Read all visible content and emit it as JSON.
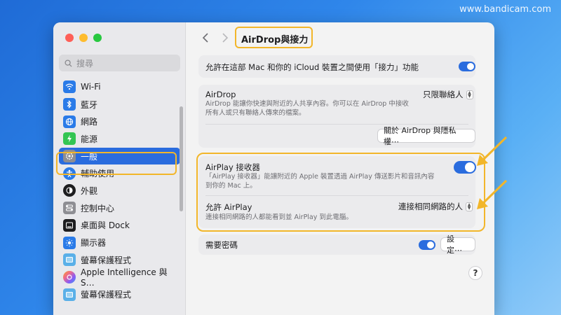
{
  "watermark": "www.bandicam.com",
  "search": {
    "placeholder": "搜尋"
  },
  "sidebar": {
    "items": [
      {
        "label": "Wi-Fi",
        "icon": "wifi-icon",
        "color": "#2a7be8"
      },
      {
        "label": "藍牙",
        "icon": "bluetooth-icon",
        "color": "#2a7be8"
      },
      {
        "label": "網路",
        "icon": "globe-icon",
        "color": "#2a7be8"
      },
      {
        "label": "能源",
        "icon": "battery-icon",
        "color": "#33c553"
      },
      {
        "label": "一般",
        "icon": "gear-icon",
        "color": "#8e8e93"
      },
      {
        "label": "輔助使用",
        "icon": "accessibility-icon",
        "color": "#2a7be8"
      },
      {
        "label": "外觀",
        "icon": "appearance-icon",
        "color": "#1d1d1f"
      },
      {
        "label": "控制中心",
        "icon": "control-center-icon",
        "color": "#8e8e93"
      },
      {
        "label": "桌面與 Dock",
        "icon": "dock-icon",
        "color": "#1d1d1f"
      },
      {
        "label": "顯示器",
        "icon": "display-icon",
        "color": "#2a7be8"
      },
      {
        "label": "螢幕保護程式",
        "icon": "screensaver-icon",
        "color": "#5ab0e8"
      },
      {
        "label": "Apple Intelligence 與 S…",
        "icon": "apple-intelligence-icon",
        "color": "#f06a8a"
      },
      {
        "label": "螢幕保護程式",
        "icon": "screensaver-icon",
        "color": "#5ab0e8"
      }
    ]
  },
  "header": {
    "title": "AirDrop與接力"
  },
  "handoff": {
    "label": "允許在這部 Mac 和你的 iCloud 裝置之間使用「接力」功能",
    "enabled": true
  },
  "airdrop": {
    "title": "AirDrop",
    "desc_line1": "AirDrop 能讓你快速與附近的人共享內容。你可以在 AirDrop 中接收",
    "desc_line2": "所有人或只有聯絡人傳來的檔案。",
    "selected": "只限聯絡人",
    "privacy_button": "關於 AirDrop 與隱私權⋯"
  },
  "airplay": {
    "title": "AirPlay 接收器",
    "desc_line1": "「AirPlay 接收器」能讓附近的 Apple 裝置透過 AirPlay 傳送影片和音訊內容",
    "desc_line2": "到你的 Mac 上。",
    "enabled": true,
    "allow_title": "允許 AirPlay",
    "allow_desc": "連接相同網路的人都能看到並 AirPlay 到此電腦。",
    "allow_selected": "連接相同網路的人"
  },
  "password": {
    "label": "需要密碼",
    "enabled": true,
    "settings_button": "設定⋯"
  },
  "help": "?"
}
